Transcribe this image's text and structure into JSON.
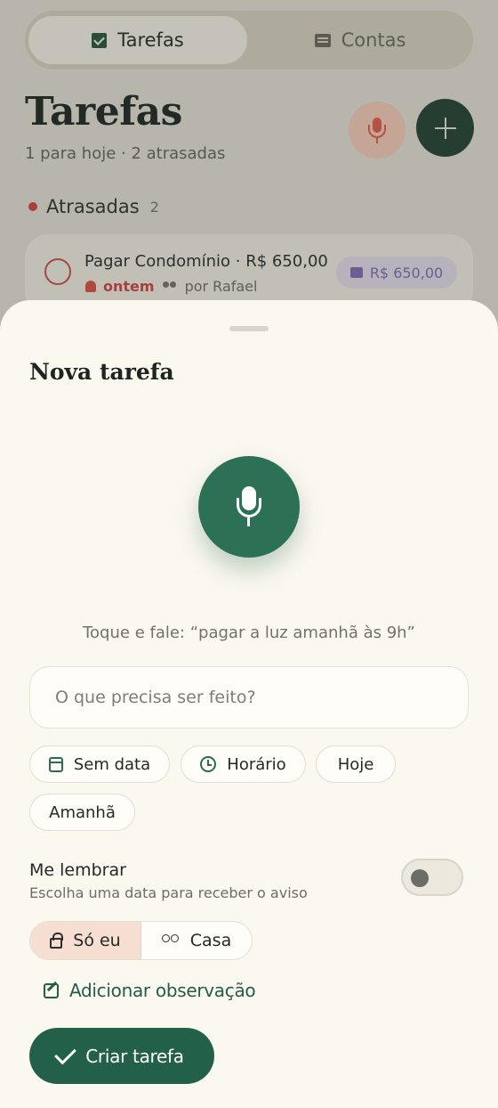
{
  "tabs": [
    {
      "label": "Tarefas",
      "icon": "checkbox-icon",
      "active": true
    },
    {
      "label": "Contas",
      "icon": "message-icon",
      "active": false
    }
  ],
  "header": {
    "title": "Tarefas",
    "subtitle": "1 para hoje · 2 atrasadas"
  },
  "section": {
    "label": "Atrasadas",
    "count": "2"
  },
  "task": {
    "title": "Pagar Condomínio · R$ 650,00",
    "due": "ontem",
    "by": "por Rafael",
    "amount": "R$ 650,00"
  },
  "sheet": {
    "title": "Nova tarefa",
    "hint": "Toque e fale: “pagar a luz amanhã às 9h”",
    "input_placeholder": "O que precisa ser feito?",
    "chips": {
      "no_date": "Sem data",
      "time": "Horário",
      "today": "Hoje",
      "tomorrow": "Amanhã"
    },
    "reminder": {
      "label": "Me lembrar",
      "description": "Escolha uma data para receber o aviso",
      "enabled": false
    },
    "visibility": {
      "only_me": "Só eu",
      "house": "Casa",
      "selected": "only_me"
    },
    "add_note": "Adicionar observação",
    "create_button": "Criar tarefa"
  },
  "colors": {
    "primary": "#236049",
    "mic": "#2c7156",
    "overdue": "#a8403a",
    "sheet_bg": "#fbf8ef"
  }
}
